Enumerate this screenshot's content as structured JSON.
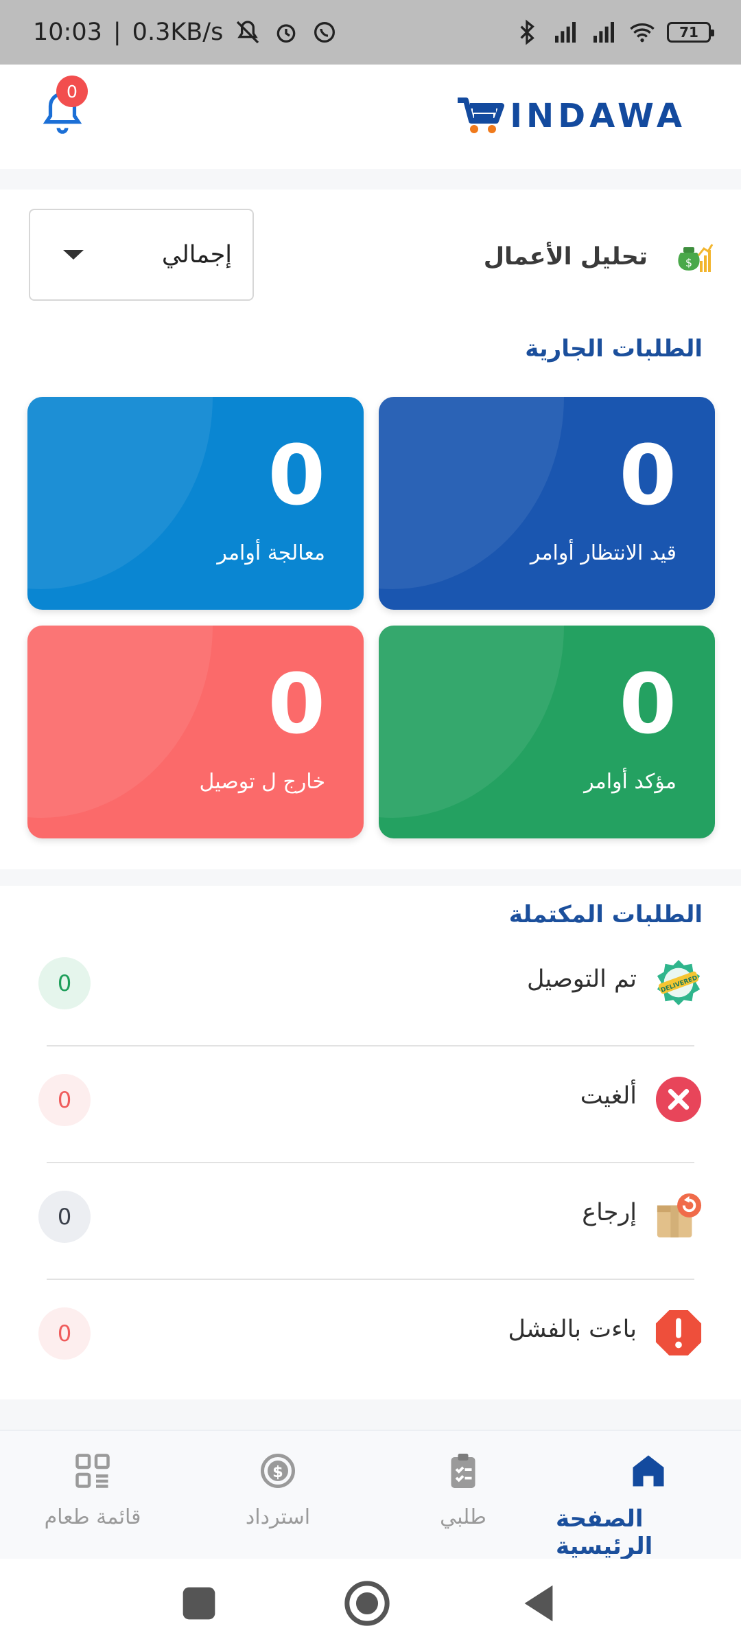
{
  "status_bar": {
    "time": "10:03",
    "network": "0.3KB/s",
    "battery": "71"
  },
  "header": {
    "brand": "INDAWA",
    "notification_count": "0"
  },
  "analysis": {
    "title": "تحليل الأعمال",
    "period_selected": "إجمالي"
  },
  "current_orders": {
    "title": "الطلبات الجارية",
    "tiles": [
      {
        "count": "0",
        "label": "قيد الانتظار  أوامر",
        "color": "#1a56b0"
      },
      {
        "count": "0",
        "label": "معالجة  أوامر",
        "color": "#0a86d2"
      },
      {
        "count": "0",
        "label": "مؤكد  أوامر",
        "color": "#24a161"
      },
      {
        "count": "0",
        "label": "خارج ل توصيل",
        "color": "#fb6a6a"
      }
    ]
  },
  "completed_orders": {
    "title": "الطلبات المكتملة",
    "rows": [
      {
        "name": "تم التوصيل",
        "count": "0",
        "icon": "delivered-badge-icon",
        "pill_bg": "#e5f5ec",
        "pill_fg": "#1e9e5a"
      },
      {
        "name": "ألغيت",
        "count": "0",
        "icon": "cancel-x-icon",
        "pill_bg": "#fdeeee",
        "pill_fg": "#ef5b5b"
      },
      {
        "name": "إرجاع",
        "count": "0",
        "icon": "return-box-icon",
        "pill_bg": "#eceef2",
        "pill_fg": "#3a3f4a"
      },
      {
        "name": "باءت بالفشل",
        "count": "0",
        "icon": "failed-alert-icon",
        "pill_bg": "#fdeeee",
        "pill_fg": "#ef5b5b"
      }
    ]
  },
  "bottom_nav": {
    "home": "الصفحة الرئيسية",
    "my_orders": "طلبي",
    "refund": "استرداد",
    "food_menu": "قائمة طعام"
  },
  "colors": {
    "brand": "#134a9e",
    "accent": "#1b4f9c"
  }
}
